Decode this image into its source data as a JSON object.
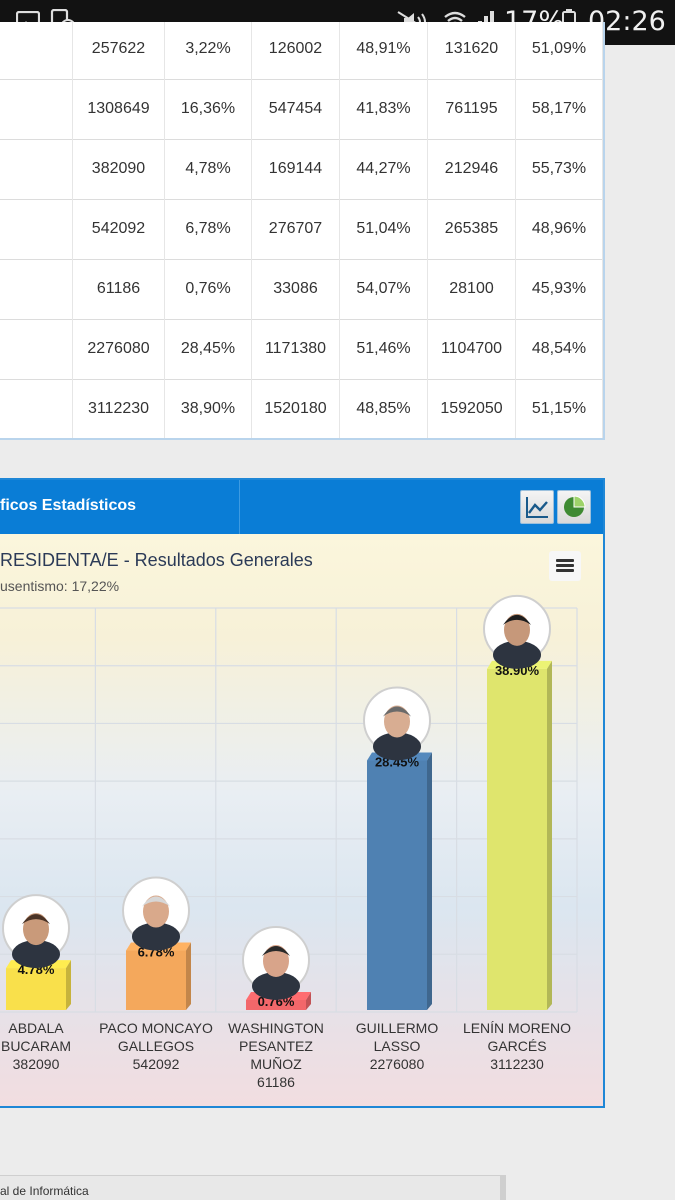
{
  "status_bar": {
    "battery_percent": "17%",
    "time": "02:26",
    "icons": [
      "image-icon",
      "download-clock-icon",
      "mute-icon",
      "wifi-icon",
      "signal-icon",
      "battery-icon"
    ]
  },
  "table": {
    "rows": [
      [
        "257622",
        "3,22%",
        "126002",
        "48,91%",
        "131620",
        "51,09%"
      ],
      [
        "1308649",
        "16,36%",
        "547454",
        "41,83%",
        "761195",
        "58,17%"
      ],
      [
        "382090",
        "4,78%",
        "169144",
        "44,27%",
        "212946",
        "55,73%"
      ],
      [
        "542092",
        "6,78%",
        "276707",
        "51,04%",
        "265385",
        "48,96%"
      ],
      [
        "61186",
        "0,76%",
        "33086",
        "54,07%",
        "28100",
        "45,93%"
      ],
      [
        "2276080",
        "28,45%",
        "1171380",
        "51,46%",
        "1104700",
        "48,54%"
      ],
      [
        "3112230",
        "38,90%",
        "1520180",
        "48,85%",
        "1592050",
        "51,15%"
      ]
    ]
  },
  "panel": {
    "header_title": "ficos Estadísticos",
    "tools": [
      "line-chart-icon",
      "pie-chart-icon"
    ]
  },
  "chart_data": {
    "type": "bar",
    "title": "RESIDENTA/E - Resultados Generales",
    "subtitle": "usentismo: 17,22%",
    "ylim": [
      0,
      40
    ],
    "grid": true,
    "categories": [
      "ABDALA BUCARAM",
      "PACO MONCAYO GALLEGOS",
      "WASHINGTON PESANTEZ MUÑOZ",
      "GUILLERMO LASSO",
      "LENÍN MORENO GARCÉS"
    ],
    "bars": [
      {
        "name_lines": [
          "ABDALA",
          "BUCARAM"
        ],
        "votes": "382090",
        "value": 4.78,
        "label": "4.78%",
        "color": "#f9e04b"
      },
      {
        "name_lines": [
          "PACO MONCAYO",
          "GALLEGOS"
        ],
        "votes": "542092",
        "value": 6.78,
        "label": "6.78%",
        "color": "#f4a85c"
      },
      {
        "name_lines": [
          "WASHINGTON",
          "PESANTEZ",
          "MUÑOZ"
        ],
        "votes": "61186",
        "value": 0.76,
        "label": "0.76%",
        "color": "#f2676a"
      },
      {
        "name_lines": [
          "GUILLERMO",
          "LASSO"
        ],
        "votes": "2276080",
        "value": 28.45,
        "label": "28.45%",
        "color": "#4f81b2"
      },
      {
        "name_lines": [
          "LENÍN MORENO",
          "GARCÉS"
        ],
        "votes": "3112230",
        "value": 38.9,
        "label": "38.90%",
        "color": "#dfe56d"
      }
    ]
  },
  "footer": {
    "text": "al de Informática"
  }
}
